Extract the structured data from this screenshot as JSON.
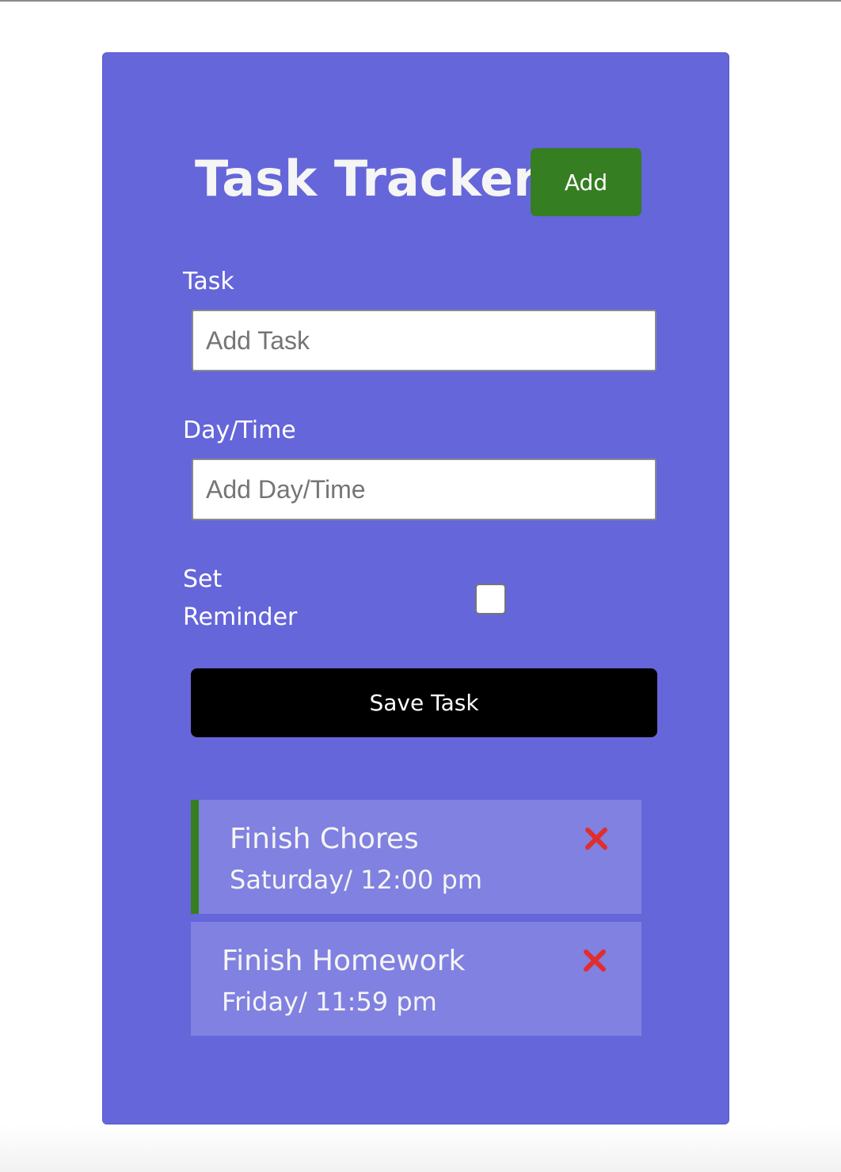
{
  "header": {
    "title": "Task Tracker",
    "add_button_label": "Add"
  },
  "form": {
    "task_label": "Task",
    "task_placeholder": "Add Task",
    "task_value": "",
    "day_label": "Day/Time",
    "day_placeholder": "Add Day/Time",
    "day_value": "",
    "reminder_label_line1": "Set",
    "reminder_label_line2": "Reminder",
    "reminder_checked": false,
    "save_button_label": "Save Task"
  },
  "tasks": [
    {
      "name": "Finish Chores",
      "day": "Saturday/ 12:00 pm",
      "reminder": true,
      "delete_icon": "x-icon"
    },
    {
      "name": "Finish Homework",
      "day": "Friday/ 11:59 pm",
      "reminder": false,
      "delete_icon": "x-icon"
    }
  ],
  "colors": {
    "panel": "#6566d9",
    "task_bg": "#8081e0",
    "add_button": "#357e21",
    "reminder_border": "#357e21",
    "save_button": "#000000",
    "delete_icon": "#e02e2e"
  }
}
